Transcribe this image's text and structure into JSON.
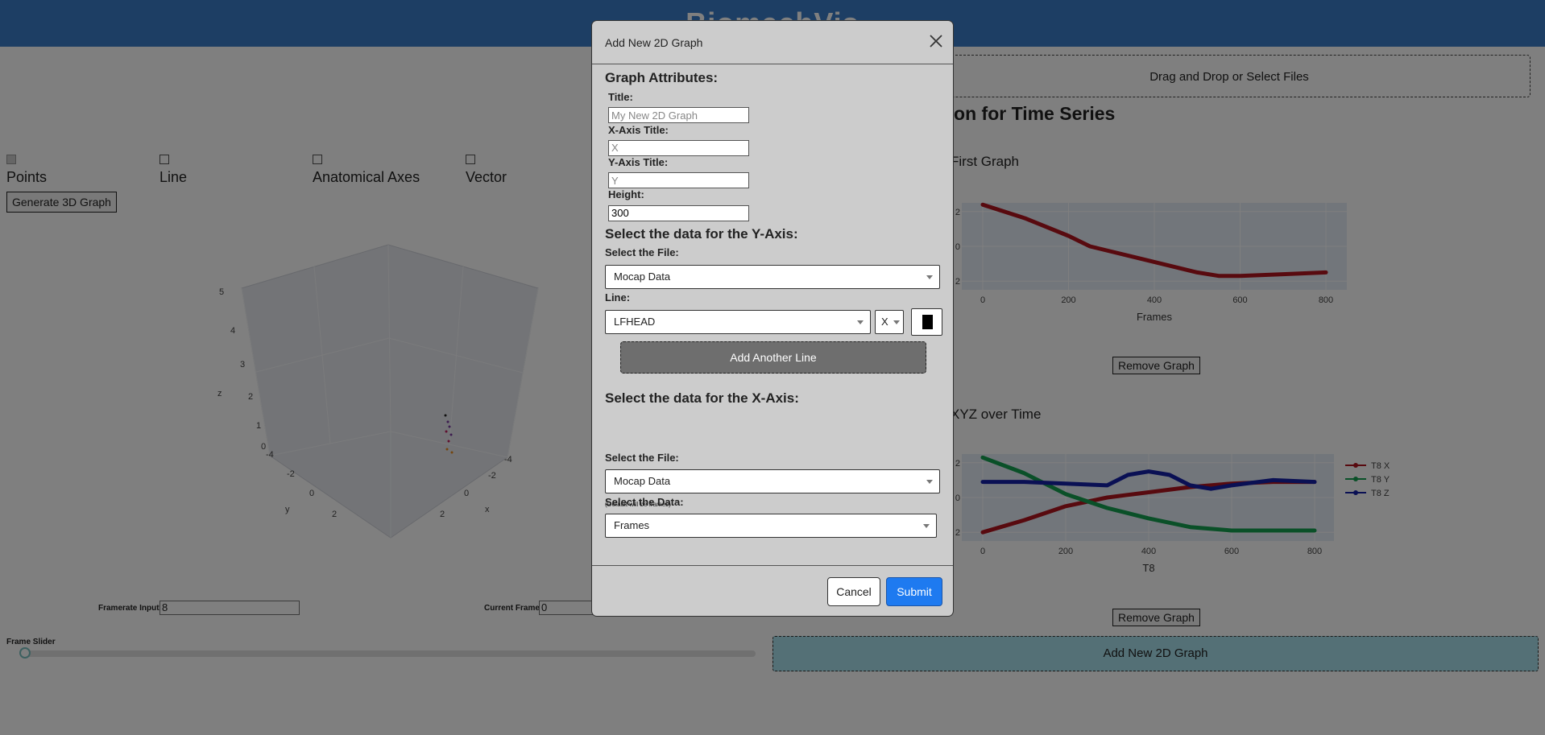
{
  "app": {
    "title": "BiomechVis"
  },
  "upload": {
    "label": "Drag and Drop or Select Files"
  },
  "section": {
    "title": "tion for Time Series"
  },
  "checkboxes": [
    {
      "label": "Points",
      "checked": true
    },
    {
      "label": "Line",
      "checked": false
    },
    {
      "label": "Anatomical Axes",
      "checked": false
    },
    {
      "label": "Vector",
      "checked": false
    }
  ],
  "generate_button": "Generate 3D Graph",
  "graph3d": {
    "z_label": "z",
    "y_label": "y",
    "x_label": "x",
    "z_ticks": [
      "5",
      "4",
      "3",
      "2",
      "1",
      "0"
    ],
    "y_ticks": [
      "-4",
      "-2",
      "0",
      "2"
    ],
    "x_ticks": [
      "-4",
      "-2",
      "0",
      "2"
    ]
  },
  "framerate": {
    "label": "Framerate Input:",
    "value": "8"
  },
  "current_frame": {
    "label": "Current Frame:",
    "value": "0"
  },
  "frame_slider": {
    "label": "Frame Slider",
    "value": 0
  },
  "charts": [
    {
      "chart_data": {
        "type": "line",
        "title": "First Graph",
        "xlabel": "Frames",
        "ylabel": "",
        "x_ticks": [
          "0",
          "200",
          "400",
          "600",
          "800"
        ],
        "y_ticks": [
          "2",
          "0",
          "2"
        ],
        "xlim": [
          0,
          800
        ],
        "ylim": [
          -2.5,
          2.5
        ],
        "grid": true,
        "series": [
          {
            "color": "#b0141e",
            "x": [
              0,
              100,
              200,
              250,
              300,
              400,
              500,
              550,
              600,
              700,
              800
            ],
            "y": [
              2.4,
              1.6,
              0.6,
              0.0,
              -0.3,
              -0.9,
              -1.5,
              -1.7,
              -1.7,
              -1.6,
              -1.5
            ]
          }
        ]
      },
      "remove_label": "Remove Graph"
    },
    {
      "chart_data": {
        "type": "line",
        "title": "XYZ over Time",
        "xlabel": "T8",
        "ylabel": "",
        "x_ticks": [
          "0",
          "200",
          "400",
          "600",
          "800"
        ],
        "y_ticks": [
          "2",
          "0",
          "2"
        ],
        "xlim": [
          0,
          800
        ],
        "ylim": [
          -2.5,
          2.5
        ],
        "grid": true,
        "legend_position": "right",
        "series": [
          {
            "name": "T8 X",
            "color": "#b0141e",
            "x": [
              0,
              100,
              200,
              300,
              400,
              500,
              600,
              700,
              800
            ],
            "y": [
              -2.0,
              -1.3,
              -0.5,
              0.0,
              0.3,
              0.6,
              0.8,
              0.9,
              0.9
            ]
          },
          {
            "name": "T8 Y",
            "color": "#14a050",
            "x": [
              0,
              100,
              200,
              300,
              400,
              500,
              600,
              700,
              800
            ],
            "y": [
              2.3,
              1.4,
              0.2,
              -0.6,
              -1.2,
              -1.7,
              -1.9,
              -1.9,
              -1.9
            ]
          },
          {
            "name": "T8 Z",
            "color": "#1420a8",
            "x": [
              0,
              100,
              200,
              300,
              350,
              400,
              450,
              500,
              550,
              600,
              700,
              800
            ],
            "y": [
              0.9,
              0.9,
              0.8,
              0.7,
              1.3,
              1.5,
              1.3,
              0.7,
              0.5,
              0.7,
              1.0,
              0.9
            ]
          }
        ]
      },
      "remove_label": "Remove Graph"
    }
  ],
  "add_graph_bar": "Add New 2D Graph",
  "modal": {
    "title": "Add New 2D Graph",
    "attributes_heading": "Graph Attributes:",
    "title_label": "Title:",
    "title_placeholder": "My New 2D Graph",
    "x_title_label": "X-Axis Title:",
    "x_title_placeholder": "X",
    "y_title_label": "Y-Axis Title:",
    "y_title_placeholder": "Y",
    "height_label": "Height:",
    "height_value": "300",
    "y_heading": "Select the data for the Y-Axis:",
    "y_file_label": "Select the File:",
    "y_file_value": "Mocap Data",
    "line_label": "Line:",
    "line_value": "LFHEAD",
    "axis_value": "X",
    "line_color": "#000000",
    "add_line_label": "Add Another Line",
    "x_heading": "Select the data for the X-Axis:",
    "x_hint": "(Default will be frames)",
    "x_file_label": "Select the File:",
    "x_file_value": "Mocap Data",
    "x_data_label": "Select the Data:",
    "x_data_value": "Frames",
    "cancel_label": "Cancel",
    "submit_label": "Submit"
  }
}
